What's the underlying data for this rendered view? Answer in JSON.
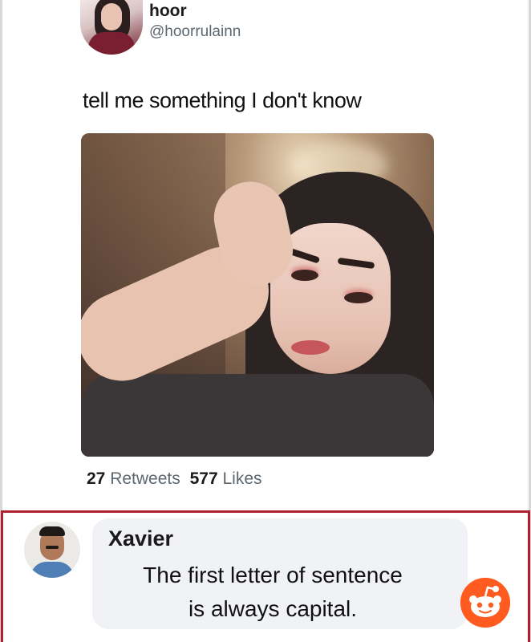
{
  "tweet": {
    "author_name": "hoor",
    "author_handle": "@hoorrulainn",
    "text": "tell me something I don't know",
    "retweets_count": "27",
    "retweets_label": "Retweets",
    "likes_count": "577",
    "likes_label": "Likes"
  },
  "reply": {
    "author_name": "Xavier",
    "text_line1": "The first letter of sentence",
    "text_line2": "is always capital."
  },
  "colors": {
    "reply_border": "#b02030",
    "bubble_bg": "#f0f2f5",
    "reddit_orange": "#ff5a1f"
  },
  "icons": {
    "watermark": "reddit-snoo-icon"
  }
}
